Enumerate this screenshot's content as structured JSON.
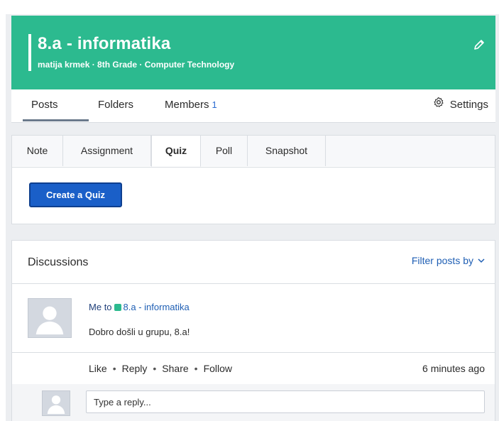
{
  "header": {
    "title": "8.a - informatika",
    "subtitle": "matija krmek · 8th Grade · Computer Technology",
    "accent_color": "#2cba8f",
    "edit_icon": "pencil-icon"
  },
  "nav": {
    "posts": "Posts",
    "folders": "Folders",
    "members": "Members",
    "members_count": "1",
    "settings": "Settings",
    "settings_icon": "gear-icon"
  },
  "composer": {
    "tabs": [
      "Note",
      "Assignment",
      "Quiz",
      "Poll",
      "Snapshot"
    ],
    "active_tab": "Quiz",
    "create_button": "Create a Quiz",
    "button_color": "#1a5fc8"
  },
  "discussions": {
    "title": "Discussions",
    "filter_label": "Filter posts by",
    "posts": [
      {
        "sender": "Me",
        "to": "to",
        "group": "8.a - informatika",
        "body": "Dobro došli u grupu, 8.a!",
        "actions": [
          "Like",
          "Reply",
          "Share",
          "Follow"
        ],
        "time": "6 minutes ago",
        "reply_placeholder": "Type a reply..."
      }
    ]
  }
}
